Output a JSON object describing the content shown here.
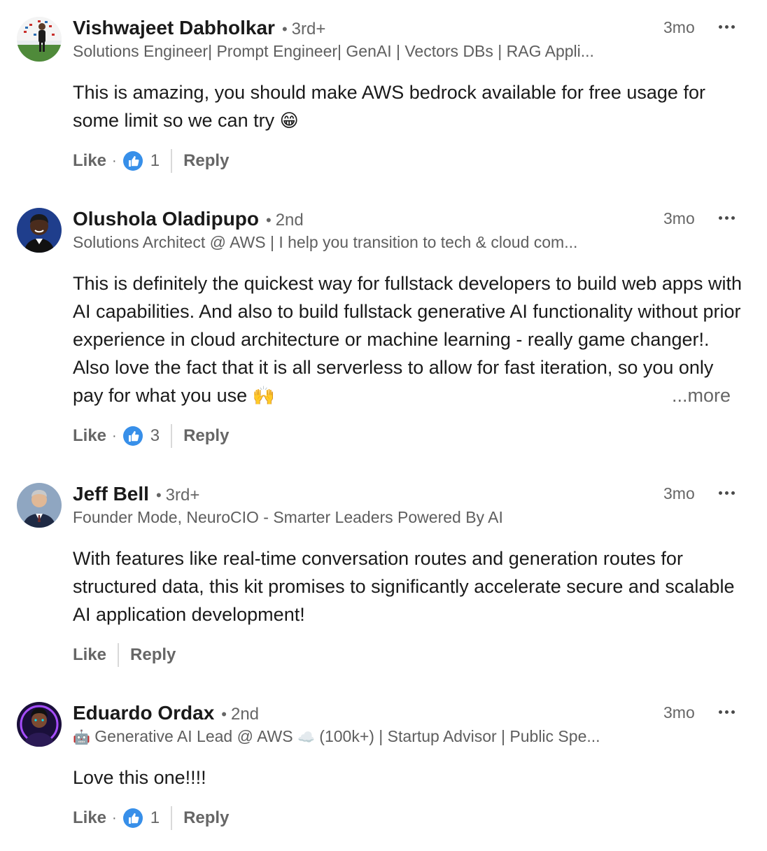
{
  "comments": [
    {
      "name": "Vishwajeet Dabholkar",
      "separator": "•",
      "degree": "3rd+",
      "headline": "Solutions Engineer| Prompt Engineer| GenAI | Vectors DBs | RAG Appli...",
      "time": "3mo",
      "text": "This is amazing, you should make AWS bedrock available for free usage for some limit so we can try",
      "emoji": "😁",
      "like_label": "Like",
      "dot": "·",
      "reaction_count": "1",
      "reply_label": "Reply"
    },
    {
      "name": "Olushola Oladipupo",
      "separator": "•",
      "degree": "2nd",
      "headline": "Solutions Architect @ AWS | I help you transition to tech & cloud com...",
      "time": "3mo",
      "text": "This is definitely the quickest way for fullstack developers to build web apps with AI capabilities. And also to build fullstack generative AI functionality without prior experience in cloud architecture or machine learning - really game changer!. Also love the fact that it is all serverless to allow for fast iteration, so you only pay for what you use",
      "emoji": "🙌",
      "see_more": "...more",
      "like_label": "Like",
      "dot": "·",
      "reaction_count": "3",
      "reply_label": "Reply"
    },
    {
      "name": "Jeff Bell",
      "separator": "•",
      "degree": "3rd+",
      "headline": "Founder Mode, NeuroCIO - Smarter Leaders Powered By AI",
      "time": "3mo",
      "text": "With features like real-time conversation routes and generation routes for structured data, this kit promises to significantly accelerate secure and scalable AI application development!",
      "like_label": "Like",
      "reply_label": "Reply"
    },
    {
      "name": "Eduardo Ordax",
      "separator": "•",
      "degree": "2nd",
      "headline_emoji_1": "🤖",
      "headline_part_1": "Generative AI Lead @ AWS",
      "headline_emoji_2": "☁️",
      "headline_part_2": "(100k+) | Startup Advisor | Public Spe...",
      "time": "3mo",
      "text": "Love this one!!!!",
      "like_label": "Like",
      "dot": "·",
      "reaction_count": "1",
      "reply_label": "Reply"
    }
  ],
  "colors": {
    "like_blue": "#378fe9",
    "muted_text": "#666666",
    "body_text": "#1a1a1a"
  },
  "icons": [
    "avatar",
    "like-reaction-icon",
    "more-options-icon"
  ]
}
